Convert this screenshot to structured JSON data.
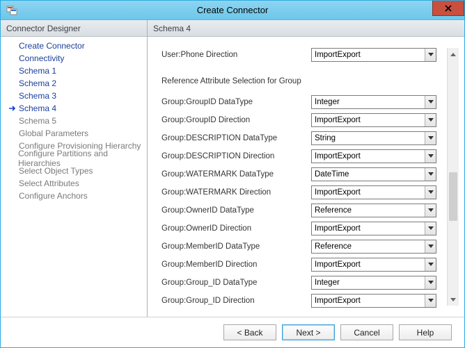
{
  "window": {
    "title": "Create Connector"
  },
  "nav": {
    "header": "Connector Designer",
    "items": [
      {
        "label": "Create Connector",
        "state": "completed"
      },
      {
        "label": "Connectivity",
        "state": "completed"
      },
      {
        "label": "Schema 1",
        "state": "completed"
      },
      {
        "label": "Schema 2",
        "state": "completed"
      },
      {
        "label": "Schema 3",
        "state": "completed"
      },
      {
        "label": "Schema 4",
        "state": "current"
      },
      {
        "label": "Schema 5",
        "state": "upcoming"
      },
      {
        "label": "Global Parameters",
        "state": "upcoming"
      },
      {
        "label": "Configure Provisioning Hierarchy",
        "state": "upcoming"
      },
      {
        "label": "Configure Partitions and Hierarchies",
        "state": "upcoming"
      },
      {
        "label": "Select Object Types",
        "state": "upcoming"
      },
      {
        "label": "Select Attributes",
        "state": "upcoming"
      },
      {
        "label": "Configure Anchors",
        "state": "upcoming"
      }
    ]
  },
  "content": {
    "header": "Schema 4",
    "top_row": {
      "label": "User:Phone Direction",
      "value": "ImportExport"
    },
    "section_heading": "Reference Attribute Selection for Group",
    "rows": [
      {
        "label": "Group:GroupID DataType",
        "value": "Integer"
      },
      {
        "label": "Group:GroupID Direction",
        "value": "ImportExport"
      },
      {
        "label": "Group:DESCRIPTION DataType",
        "value": "String"
      },
      {
        "label": "Group:DESCRIPTION Direction",
        "value": "ImportExport"
      },
      {
        "label": "Group:WATERMARK DataType",
        "value": "DateTime"
      },
      {
        "label": "Group:WATERMARK Direction",
        "value": "ImportExport"
      },
      {
        "label": "Group:OwnerID DataType",
        "value": "Reference"
      },
      {
        "label": "Group:OwnerID Direction",
        "value": "ImportExport"
      },
      {
        "label": "Group:MemberID DataType",
        "value": "Reference"
      },
      {
        "label": "Group:MemberID Direction",
        "value": "ImportExport"
      },
      {
        "label": "Group:Group_ID DataType",
        "value": "Integer"
      },
      {
        "label": "Group:Group_ID Direction",
        "value": "ImportExport"
      }
    ]
  },
  "footer": {
    "back": "<  Back",
    "next": "Next  >",
    "cancel": "Cancel",
    "help": "Help"
  }
}
